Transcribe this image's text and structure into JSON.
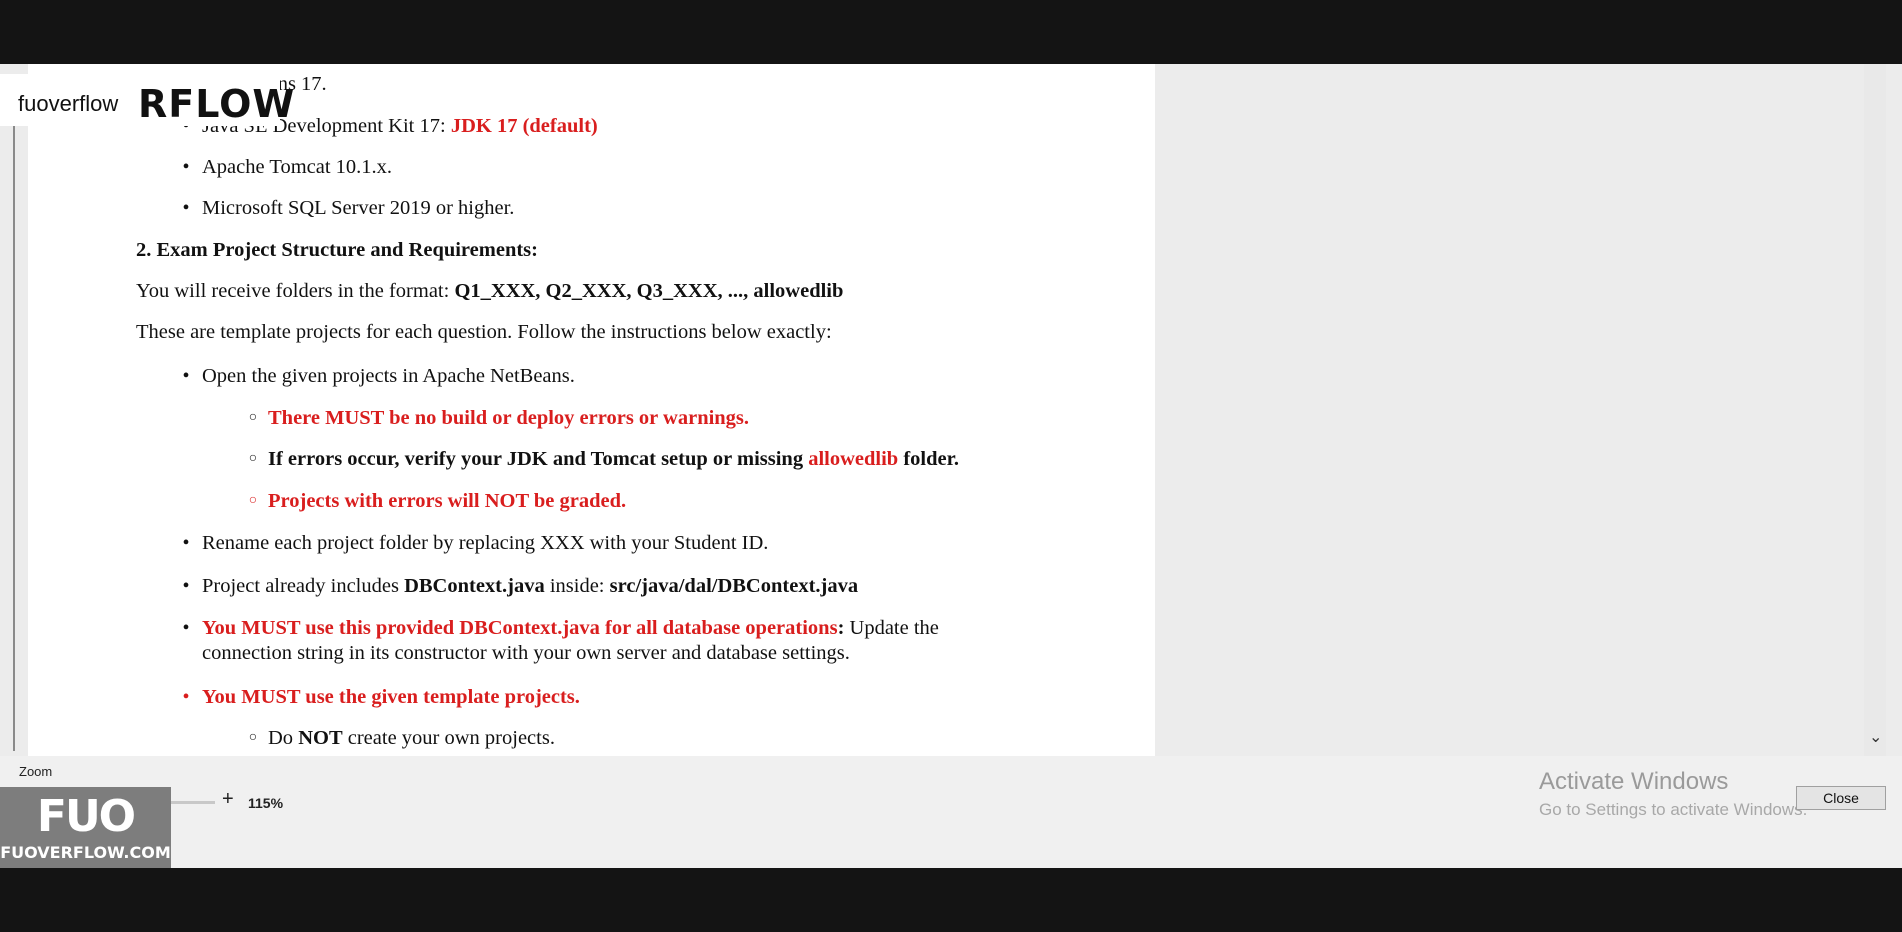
{
  "watermark": {
    "small_text": "fuoverflow",
    "big_text": "RFLOW"
  },
  "document": {
    "lines": [
      {
        "runs": [
          {
            "t": "e NetBeans 17.",
            "red": false,
            "bold": false
          }
        ]
      },
      {
        "runs": [
          {
            "t": "Java SE Development Kit 17: ",
            "red": false,
            "bold": false
          },
          {
            "t": "JDK 17 (default)",
            "red": true,
            "bold": true
          }
        ]
      },
      {
        "runs": [
          {
            "t": "Apache Tomcat 10.1.x.",
            "red": false,
            "bold": false
          }
        ]
      },
      {
        "runs": [
          {
            "t": "Microsoft SQL Server 2019 or higher.",
            "red": false,
            "bold": false
          }
        ]
      },
      {
        "runs": [
          {
            "t": "2. Exam Project Structure and Requirements:",
            "red": false,
            "bold": true
          }
        ]
      },
      {
        "runs": [
          {
            "t": "You will receive folders in the format: ",
            "red": false,
            "bold": false
          },
          {
            "t": "Q1_XXX, Q2_XXX, Q3_XXX, ..., allowedlib",
            "red": false,
            "bold": true
          }
        ]
      },
      {
        "runs": [
          {
            "t": "These are template projects for each question. Follow the instructions below exactly:",
            "red": false,
            "bold": false
          }
        ]
      },
      {
        "runs": [
          {
            "t": "Open the given projects in Apache NetBeans.",
            "red": false,
            "bold": false
          }
        ]
      },
      {
        "runs": [
          {
            "t": "There MUST be no build or deploy errors or warnings.",
            "red": true,
            "bold": true
          }
        ]
      },
      {
        "runs": [
          {
            "t": "If errors occur, verify your JDK and Tomcat setup or missing ",
            "red": false,
            "bold": true
          },
          {
            "t": "allowedlib",
            "red": true,
            "bold": true
          },
          {
            "t": " folder.",
            "red": false,
            "bold": true
          }
        ]
      },
      {
        "runs": [
          {
            "t": "Projects with errors will NOT be graded.",
            "red": true,
            "bold": true
          }
        ]
      },
      {
        "runs": [
          {
            "t": "Rename each project folder by replacing XXX with your Student ID.",
            "red": false,
            "bold": false
          }
        ]
      },
      {
        "runs": [
          {
            "t": "Project already includes ",
            "red": false,
            "bold": false
          },
          {
            "t": "DBContext.java",
            "red": false,
            "bold": true
          },
          {
            "t": " inside: ",
            "red": false,
            "bold": false
          },
          {
            "t": "src/java/dal/DBContext.java",
            "red": false,
            "bold": true
          }
        ]
      },
      {
        "runs": [
          {
            "t": "You MUST use this provided DBContext.java for all database operations",
            "red": true,
            "bold": true
          },
          {
            "t": ": ",
            "red": false,
            "bold": true
          },
          {
            "t": "Update the",
            "red": false,
            "bold": false
          }
        ]
      },
      {
        "runs": [
          {
            "t": "connection string in its constructor with your own server and database settings.",
            "red": false,
            "bold": false
          }
        ]
      },
      {
        "runs": [
          {
            "t": "You MUST use the given template projects.",
            "red": true,
            "bold": true
          }
        ]
      },
      {
        "runs": [
          {
            "t": "Do ",
            "red": false,
            "bold": false
          },
          {
            "t": "NOT",
            "red": false,
            "bold": true
          },
          {
            "t": " create your own projects.",
            "red": false,
            "bold": false
          }
        ]
      }
    ],
    "bullets": [
      {
        "char": "•",
        "red": false
      },
      {
        "char": "•",
        "red": false
      },
      {
        "char": "•",
        "red": false
      },
      {
        "char": "•",
        "red": false
      },
      {
        "char": "○",
        "red": false
      },
      {
        "char": "○",
        "red": false
      },
      {
        "char": "○",
        "red": true
      },
      {
        "char": "•",
        "red": false
      },
      {
        "char": "•",
        "red": false
      },
      {
        "char": "•",
        "red": false
      },
      {
        "char": "•",
        "red": true
      },
      {
        "char": "○",
        "red": false
      }
    ]
  },
  "zoom": {
    "label": "Zoom",
    "minus": "-",
    "plus": "+",
    "value": "115%",
    "level_percent": 115
  },
  "activation": {
    "title": "Activate Windows",
    "subtitle": "Go to Settings to activate Windows."
  },
  "close_label": "Close",
  "logo": {
    "mark": "FUO",
    "url": "FUOVERFLOW.COM"
  },
  "icons": {
    "scroll_down": "chevron-down-icon"
  },
  "colors": {
    "emphasis_red": "#d91e1e",
    "zoom_thumb": "#1a64a8"
  }
}
